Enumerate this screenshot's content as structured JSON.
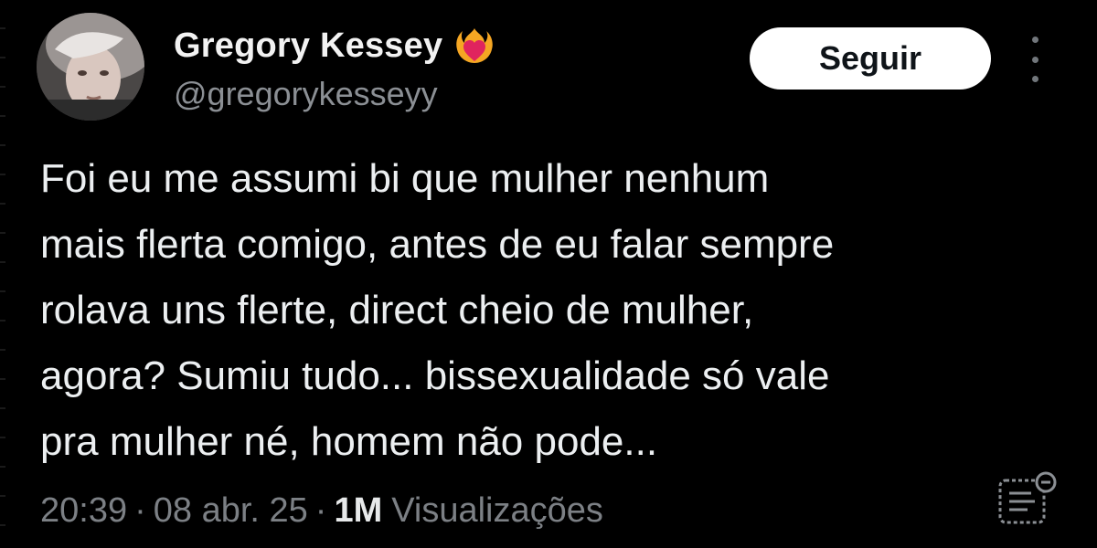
{
  "author": {
    "display_name": "Gregory Kessey",
    "handle": "@gregorykesseyy",
    "flair_icon": "heart-on-fire-icon",
    "avatar_icon": "profile-photo"
  },
  "actions": {
    "follow_label": "Seguir",
    "more_icon": "more-vertical-icon"
  },
  "tweet": {
    "lines": [
      "Foi eu me assumi bi que mulher nenhum",
      "mais flerta comigo, antes de eu falar sempre",
      "rolava uns flerte, direct cheio de mulher,",
      "agora? Sumiu tudo... bissexualidade só vale",
      "pra mulher né, homem não pode..."
    ]
  },
  "meta": {
    "time": "20:39",
    "separator": "·",
    "date": "08 abr. 25",
    "views_count": "1M",
    "views_label": "Visualizações",
    "analytics_icon": "analytics-icon"
  },
  "colors": {
    "background": "#000000",
    "text": "#e7e9ea",
    "muted": "#7c8085",
    "button_bg": "#ffffff",
    "button_text": "#0f1419",
    "flair": "#e0245e"
  }
}
